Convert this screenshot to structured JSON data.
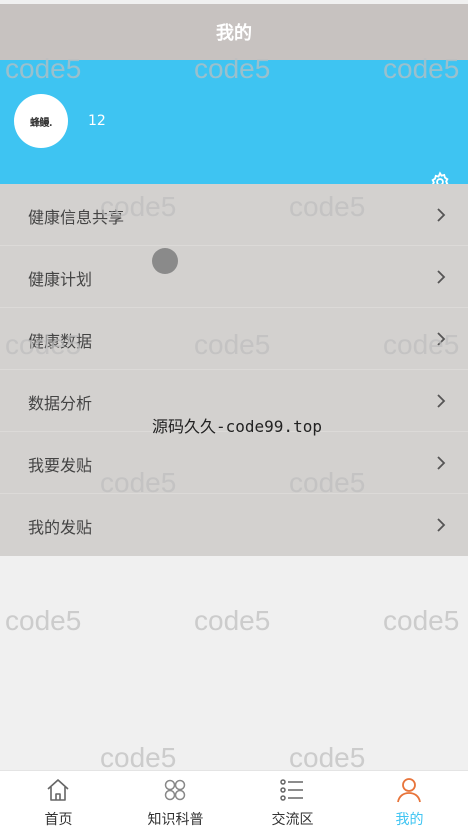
{
  "header": {
    "title": "我的"
  },
  "profile": {
    "avatar_text": "蜂鳗.",
    "username": "12",
    "settings_icon": "gear-icon",
    "background_color": "#3ec4f2"
  },
  "menu": {
    "items": [
      {
        "label": "健康信息共享",
        "icon": "chevron-right-icon"
      },
      {
        "label": "健康计划",
        "icon": "chevron-right-icon"
      },
      {
        "label": "健康数据",
        "icon": "chevron-right-icon"
      },
      {
        "label": "数据分析",
        "icon": "chevron-right-icon"
      },
      {
        "label": "我要发贴",
        "icon": "chevron-right-icon"
      },
      {
        "label": "我的发贴",
        "icon": "chevron-right-icon"
      }
    ]
  },
  "overlay": {
    "center_text": "源码久久-code99.top",
    "watermark_text": "code5"
  },
  "tabbar": {
    "active_color": "#3ec4f2",
    "tabs": [
      {
        "label": "首页",
        "icon": "home-icon",
        "active": false
      },
      {
        "label": "知识科普",
        "icon": "grid-icon",
        "active": false
      },
      {
        "label": "交流区",
        "icon": "list-icon",
        "active": false
      },
      {
        "label": "我的",
        "icon": "user-icon",
        "active": true
      }
    ]
  }
}
